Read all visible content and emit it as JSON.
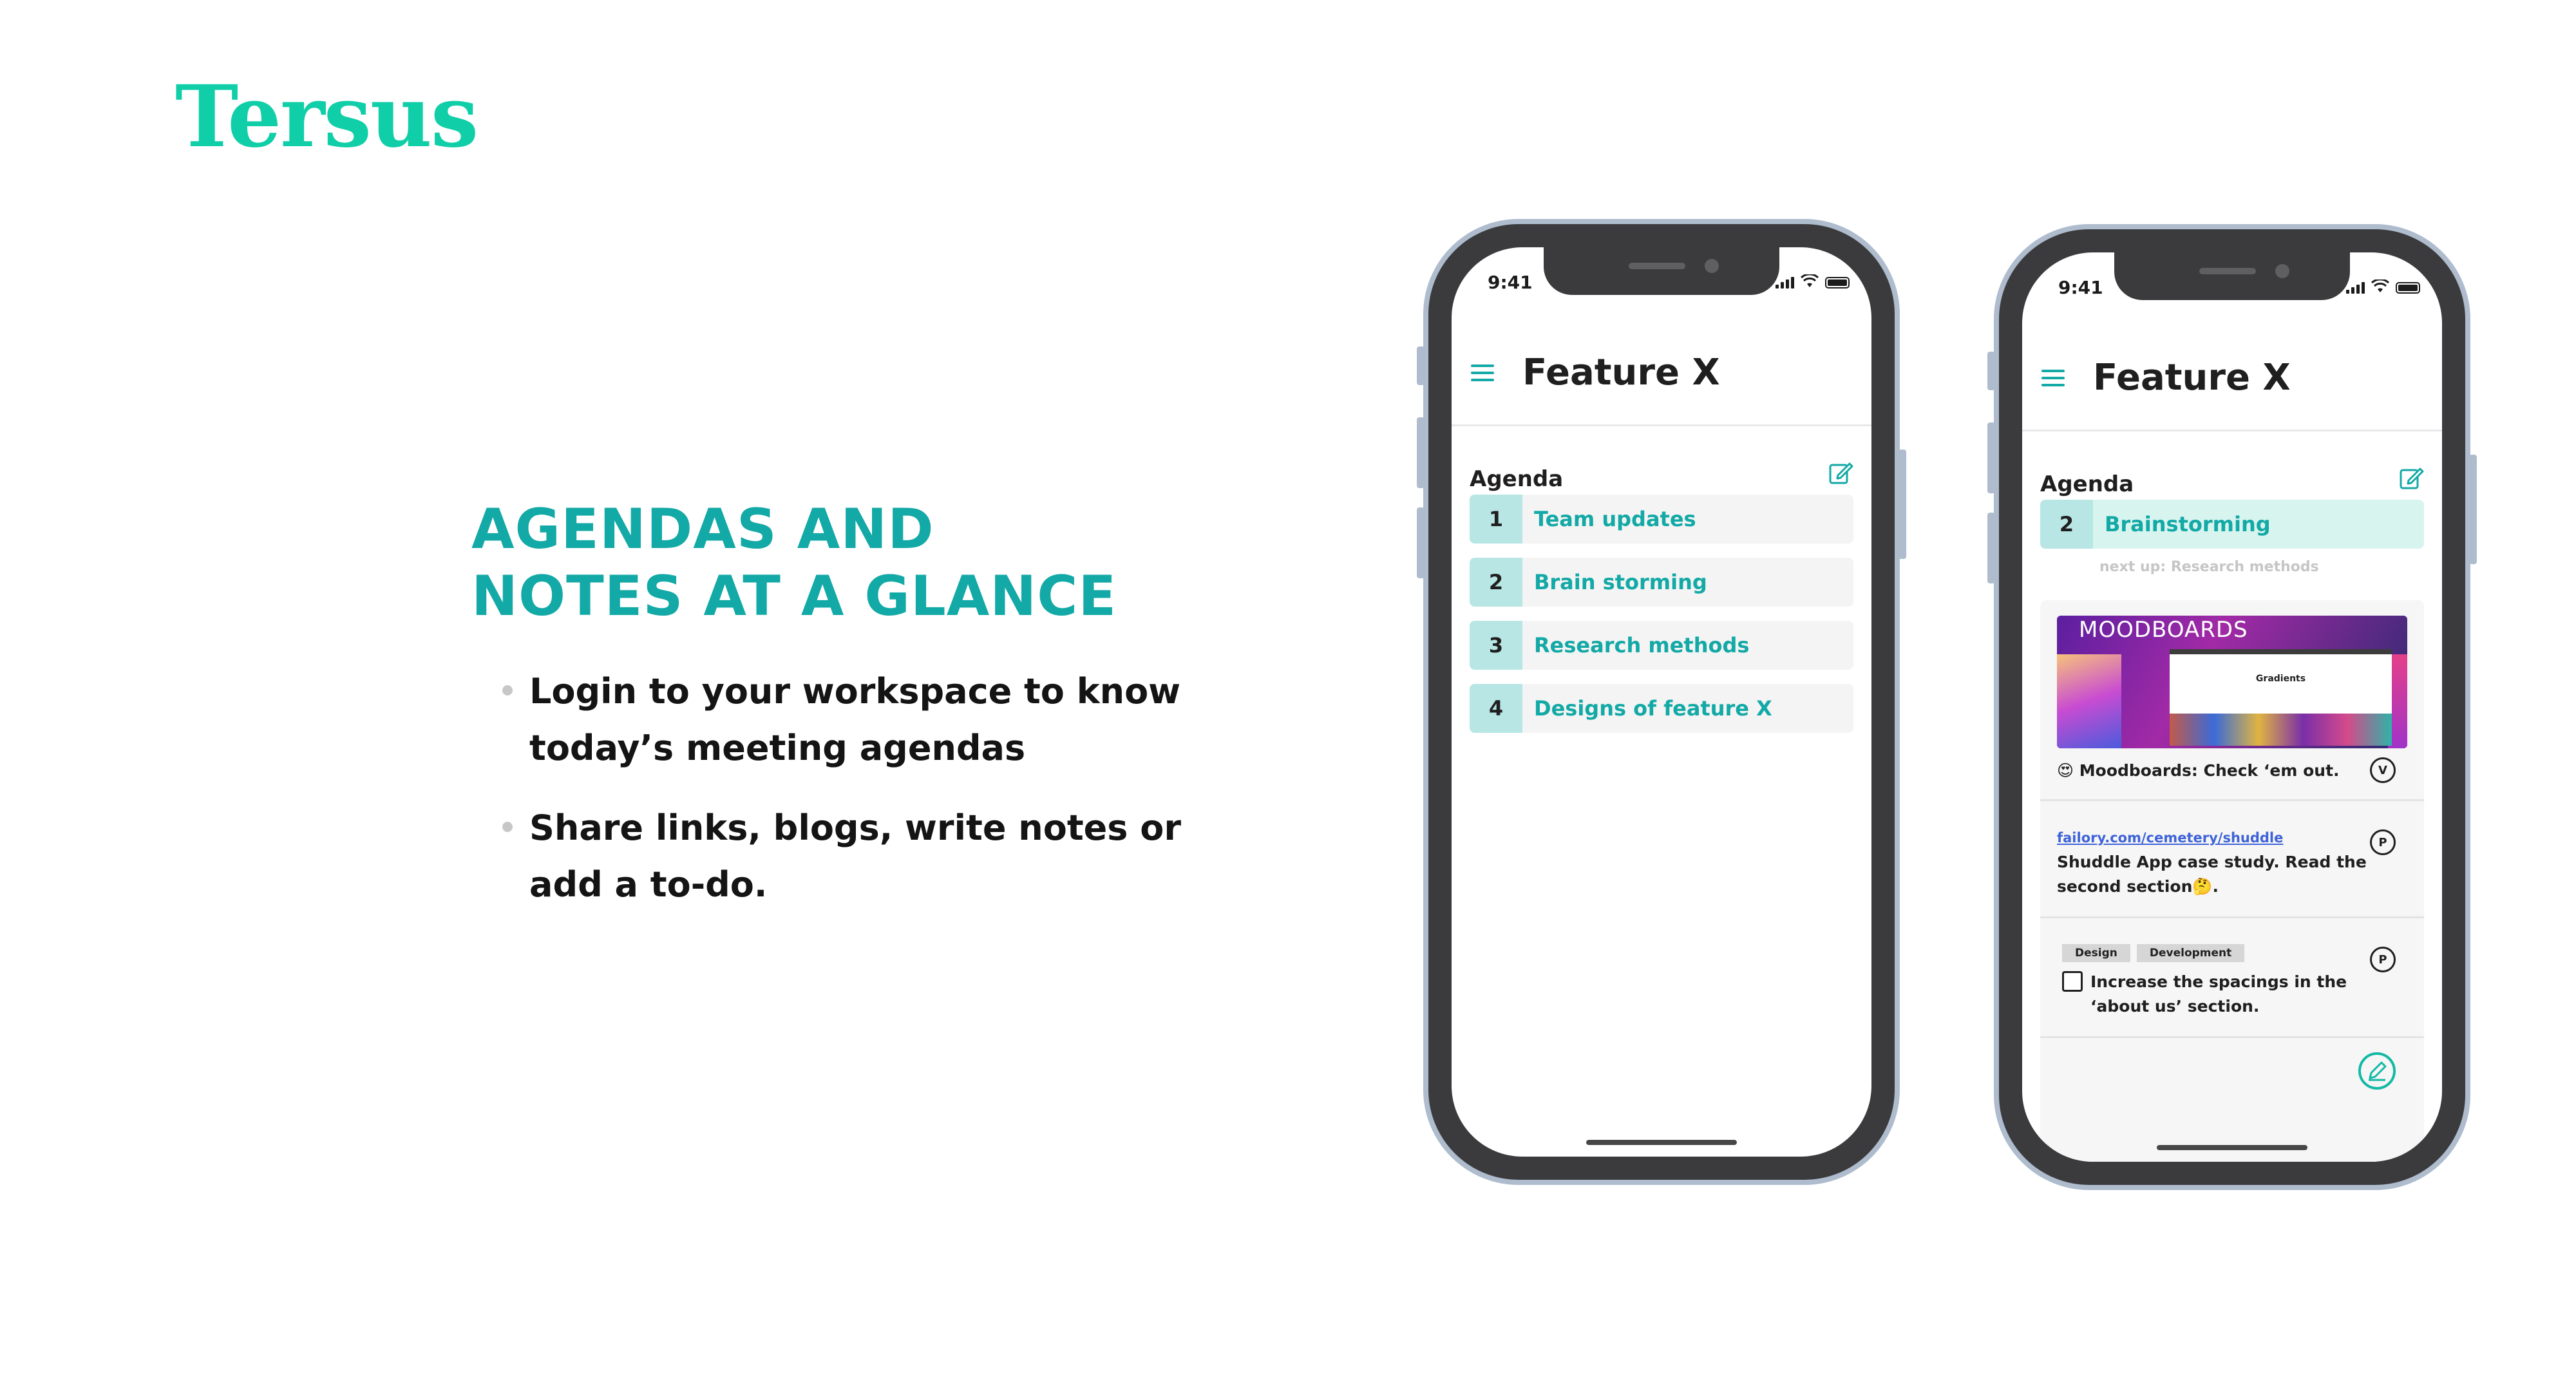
{
  "brand": {
    "name": "Tersus"
  },
  "hero": {
    "headline_line1": "AGENDAS AND",
    "headline_line2": "NOTES AT A GLANCE",
    "bullets": [
      "Login to your workspace to know today’s meeting agendas",
      "Share links, blogs, write notes or add a to-do."
    ]
  },
  "colors": {
    "accent": "#13a9a6",
    "brand": "#10cfa8",
    "number_chip": "#b7e6e4",
    "current_item_bg": "#d8f4ef",
    "link": "#3f63d8"
  },
  "phone1": {
    "time": "9:41",
    "title": "Feature X",
    "agenda_label": "Agenda",
    "agenda": [
      {
        "num": "1",
        "label": "Team updates"
      },
      {
        "num": "2",
        "label": "Brain storming"
      },
      {
        "num": "3",
        "label": "Research methods"
      },
      {
        "num": "4",
        "label": "Designs of feature X"
      }
    ]
  },
  "phone2": {
    "time": "9:41",
    "title": "Feature X",
    "agenda_label": "Agenda",
    "current": {
      "num": "2",
      "label": "Brainstorming"
    },
    "next_up": "next up: Research methods",
    "notes": {
      "moodboard_title": "MOODBOARDS",
      "moodboard_window_title": "Gradients",
      "moodboard_caption": "😍 Moodboards: Check ‘em out.",
      "moodboard_badge": "V",
      "link_url": "failory.com/cemetery/shuddle",
      "link_text_1": "Shuddle App case study. Read the",
      "link_text_2": "second section🤔.",
      "link_badge": "P",
      "tags": [
        "Design",
        "Development"
      ],
      "todo_line1": "Increase the spacings in the",
      "todo_line2": "‘about us’ section.",
      "todo_badge": "P"
    }
  }
}
